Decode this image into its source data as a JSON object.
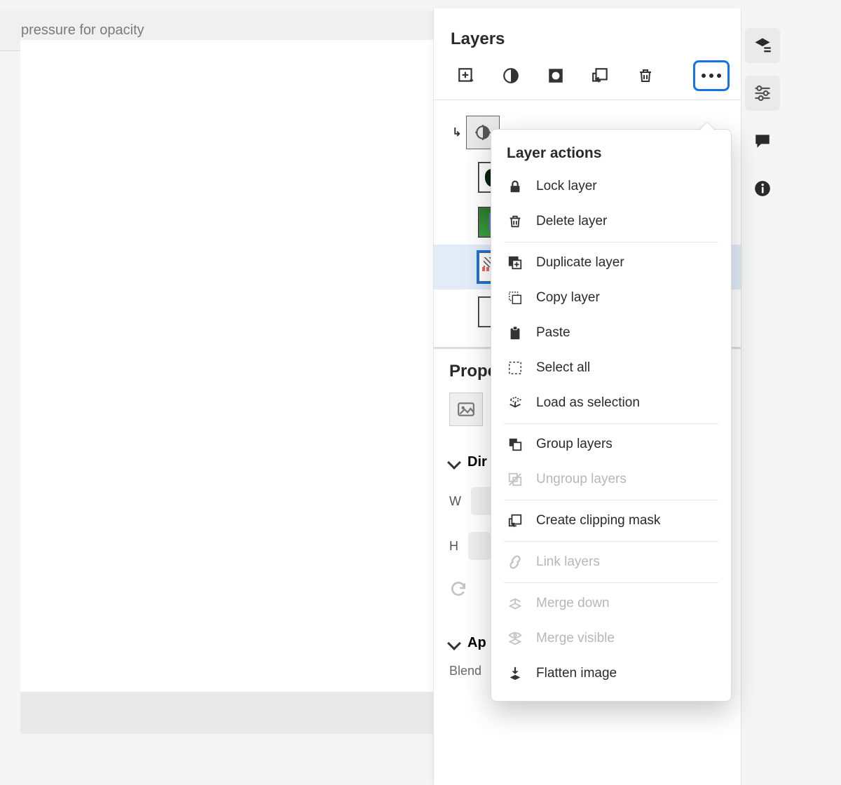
{
  "options_bar": {
    "hint": "pressure for opacity"
  },
  "layers_panel": {
    "title": "Layers",
    "toolbar": {
      "new_layer": "New layer",
      "adjustment": "Adjustment layer",
      "mask": "Add mask",
      "clip": "Clipping mask",
      "delete": "Delete layer",
      "more": "More actions"
    }
  },
  "properties": {
    "title": "Prope",
    "dim_section": "Dir",
    "w_label": "W",
    "h_label": "H",
    "appearance_section": "Ap",
    "blend_label": "Blend"
  },
  "menu": {
    "title": "Layer actions",
    "items": [
      {
        "id": "lock",
        "label": "Lock layer",
        "icon": "lock-icon",
        "disabled": false,
        "sep": false
      },
      {
        "id": "delete",
        "label": "Delete layer",
        "icon": "trash-icon",
        "disabled": false,
        "sep": true
      },
      {
        "id": "duplicate",
        "label": "Duplicate layer",
        "icon": "duplicate-icon",
        "disabled": false,
        "sep": false
      },
      {
        "id": "copy",
        "label": "Copy layer",
        "icon": "copy-icon",
        "disabled": false,
        "sep": false
      },
      {
        "id": "paste",
        "label": "Paste",
        "icon": "paste-icon",
        "disabled": false,
        "sep": false
      },
      {
        "id": "selectall",
        "label": "Select all",
        "icon": "select-all-icon",
        "disabled": false,
        "sep": false
      },
      {
        "id": "loadsel",
        "label": "Load as selection",
        "icon": "load-selection-icon",
        "disabled": false,
        "sep": true
      },
      {
        "id": "group",
        "label": "Group layers",
        "icon": "group-icon",
        "disabled": false,
        "sep": false
      },
      {
        "id": "ungroup",
        "label": "Ungroup layers",
        "icon": "ungroup-icon",
        "disabled": true,
        "sep": true
      },
      {
        "id": "clip",
        "label": "Create clipping mask",
        "icon": "clipping-mask-icon",
        "disabled": false,
        "sep": true
      },
      {
        "id": "link",
        "label": "Link layers",
        "icon": "link-icon",
        "disabled": true,
        "sep": true
      },
      {
        "id": "mdown",
        "label": "Merge down",
        "icon": "merge-down-icon",
        "disabled": true,
        "sep": false
      },
      {
        "id": "mvis",
        "label": "Merge visible",
        "icon": "merge-visible-icon",
        "disabled": true,
        "sep": false
      },
      {
        "id": "flatten",
        "label": "Flatten image",
        "icon": "flatten-icon",
        "disabled": false,
        "sep": false
      }
    ]
  }
}
